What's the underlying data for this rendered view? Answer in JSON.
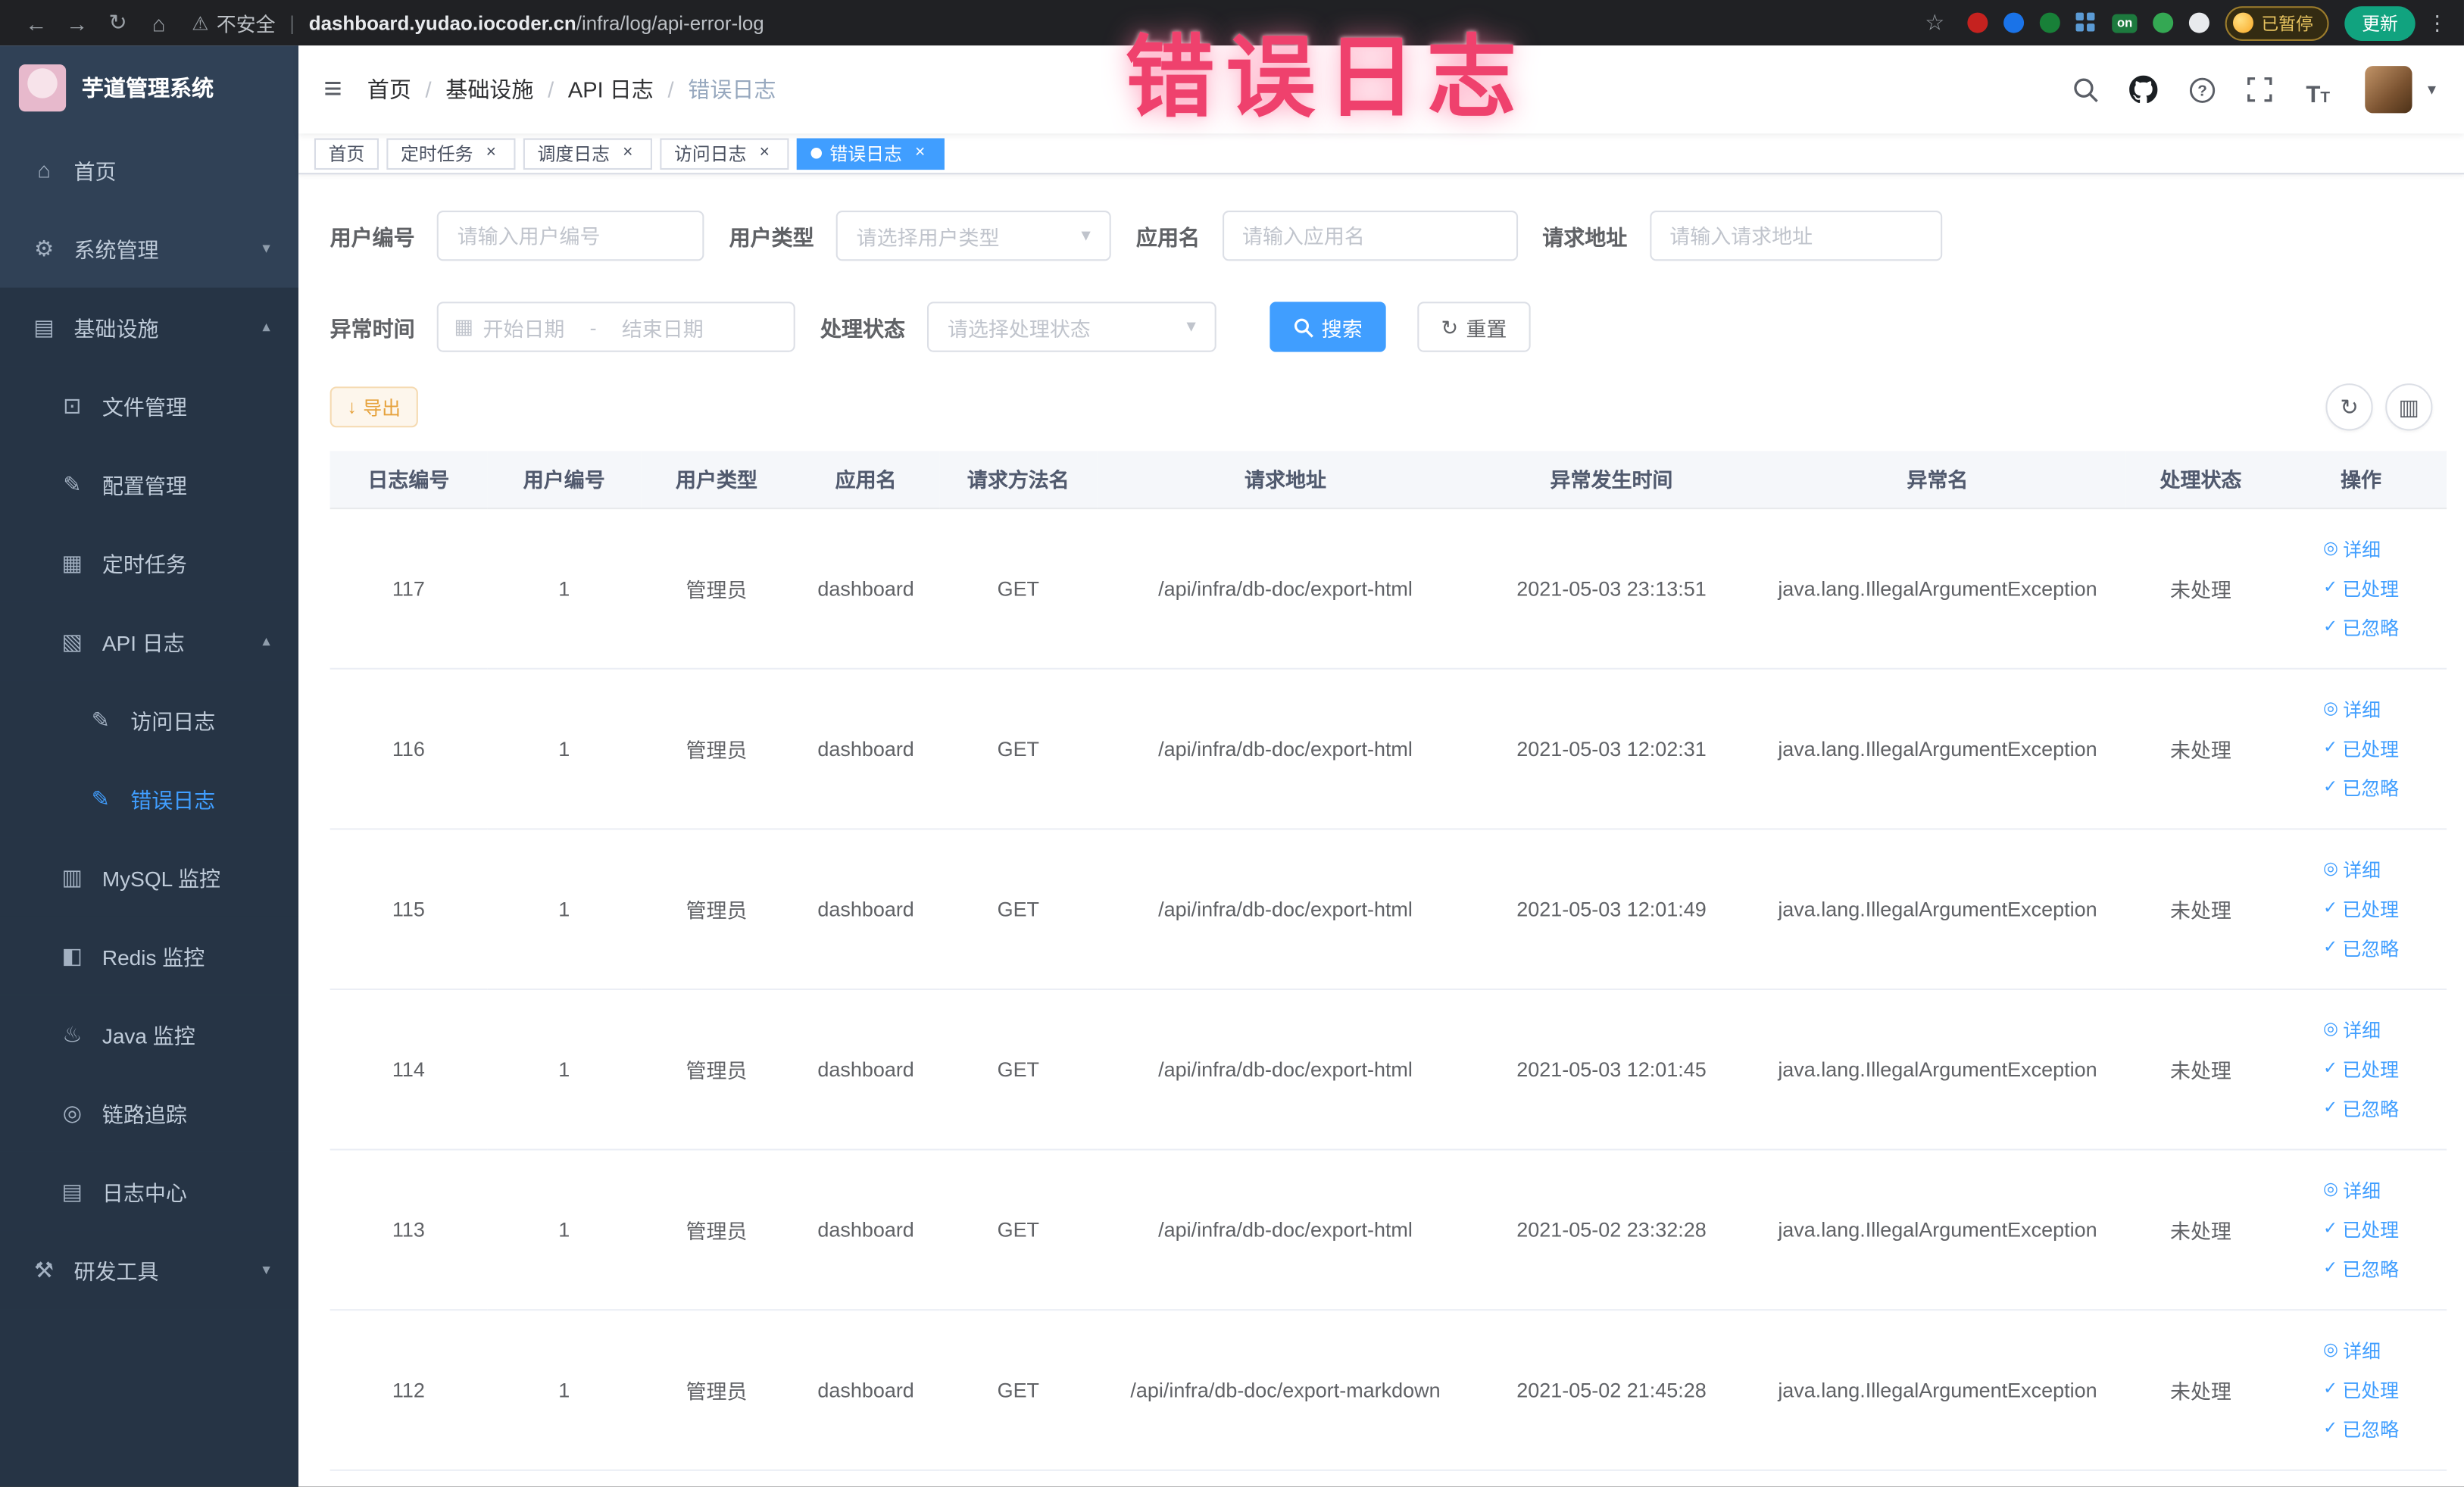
{
  "annotation": {
    "text": "错误日志"
  },
  "browser": {
    "security_label": "不安全",
    "url_host": "dashboard.yudao.iocoder.cn",
    "url_path": "/infra/log/api-error-log",
    "paused_badge": "已暂停",
    "update_button": "更新",
    "extension_on_badge": "on"
  },
  "sidebar": {
    "logo_title": "芋道管理系统",
    "items": [
      {
        "key": "home",
        "label": "首页",
        "icon": "home-icon",
        "level": 0,
        "dark": false,
        "active": false,
        "chevron": null
      },
      {
        "key": "system-management",
        "label": "系统管理",
        "icon": "gear-icon",
        "level": 0,
        "dark": false,
        "active": false,
        "chevron": "down"
      },
      {
        "key": "infrastructure",
        "label": "基础设施",
        "icon": "infrastructure-icon",
        "level": 0,
        "dark": true,
        "active": false,
        "chevron": "up"
      },
      {
        "key": "file-management",
        "label": "文件管理",
        "icon": "file-icon",
        "level": 1,
        "dark": true,
        "active": false,
        "chevron": null
      },
      {
        "key": "config-management",
        "label": "配置管理",
        "icon": "config-icon",
        "level": 1,
        "dark": true,
        "active": false,
        "chevron": null
      },
      {
        "key": "scheduled-tasks",
        "label": "定时任务",
        "icon": "timer-icon",
        "level": 1,
        "dark": true,
        "active": false,
        "chevron": null
      },
      {
        "key": "api-log",
        "label": "API 日志",
        "icon": "api-log-icon",
        "level": 1,
        "dark": true,
        "active": false,
        "chevron": "up"
      },
      {
        "key": "access-log",
        "label": "访问日志",
        "icon": "access-log-icon",
        "level": 2,
        "dark": true,
        "active": false,
        "chevron": null
      },
      {
        "key": "error-log",
        "label": "错误日志",
        "icon": "error-log-icon",
        "level": 2,
        "dark": true,
        "active": true,
        "chevron": null
      },
      {
        "key": "mysql-monitor",
        "label": "MySQL 监控",
        "icon": "mysql-icon",
        "level": 1,
        "dark": true,
        "active": false,
        "chevron": null
      },
      {
        "key": "redis-monitor",
        "label": "Redis 监控",
        "icon": "redis-icon",
        "level": 1,
        "dark": true,
        "active": false,
        "chevron": null
      },
      {
        "key": "java-monitor",
        "label": "Java 监控",
        "icon": "java-icon",
        "level": 1,
        "dark": true,
        "active": false,
        "chevron": null
      },
      {
        "key": "link-trace",
        "label": "链路追踪",
        "icon": "trace-icon",
        "level": 1,
        "dark": true,
        "active": false,
        "chevron": null
      },
      {
        "key": "log-center",
        "label": "日志中心",
        "icon": "log-center-icon",
        "level": 1,
        "dark": true,
        "active": false,
        "chevron": null
      },
      {
        "key": "dev-tools",
        "label": "研发工具",
        "icon": "devtools-icon",
        "level": 0,
        "dark": true,
        "active": false,
        "chevron": "down"
      }
    ]
  },
  "navbar": {
    "breadcrumb": [
      "首页",
      "基础设施",
      "API 日志",
      "错误日志"
    ]
  },
  "tags": [
    {
      "label": "首页",
      "closable": false,
      "active": false
    },
    {
      "label": "定时任务",
      "closable": true,
      "active": false
    },
    {
      "label": "调度日志",
      "closable": true,
      "active": false
    },
    {
      "label": "访问日志",
      "closable": true,
      "active": false
    },
    {
      "label": "错误日志",
      "closable": true,
      "active": true
    }
  ],
  "filters": {
    "user_id": {
      "label": "用户编号",
      "placeholder": "请输入用户编号"
    },
    "user_type": {
      "label": "用户类型",
      "placeholder": "请选择用户类型"
    },
    "app_name": {
      "label": "应用名",
      "placeholder": "请输入应用名"
    },
    "request_url": {
      "label": "请求地址",
      "placeholder": "请输入请求地址"
    },
    "exception_time": {
      "label": "异常时间",
      "start_placeholder": "开始日期",
      "separator": "-",
      "end_placeholder": "结束日期"
    },
    "process_status": {
      "label": "处理状态",
      "placeholder": "请选择处理状态"
    },
    "search_button": "搜索",
    "reset_button": "重置"
  },
  "toolbar": {
    "export_button": "导出"
  },
  "table": {
    "columns": [
      "日志编号",
      "用户编号",
      "用户类型",
      "应用名",
      "请求方法名",
      "请求地址",
      "异常发生时间",
      "异常名",
      "处理状态",
      "操作"
    ],
    "row_actions": [
      "详细",
      "已处理",
      "已忽略"
    ],
    "rows": [
      {
        "id": "117",
        "user_id": "1",
        "user_type": "管理员",
        "app": "dashboard",
        "method": "GET",
        "url": "/api/infra/db-doc/export-html",
        "time": "2021-05-03 23:13:51",
        "exception": "java.lang.IllegalArgumentException",
        "status": "未处理"
      },
      {
        "id": "116",
        "user_id": "1",
        "user_type": "管理员",
        "app": "dashboard",
        "method": "GET",
        "url": "/api/infra/db-doc/export-html",
        "time": "2021-05-03 12:02:31",
        "exception": "java.lang.IllegalArgumentException",
        "status": "未处理"
      },
      {
        "id": "115",
        "user_id": "1",
        "user_type": "管理员",
        "app": "dashboard",
        "method": "GET",
        "url": "/api/infra/db-doc/export-html",
        "time": "2021-05-03 12:01:49",
        "exception": "java.lang.IllegalArgumentException",
        "status": "未处理"
      },
      {
        "id": "114",
        "user_id": "1",
        "user_type": "管理员",
        "app": "dashboard",
        "method": "GET",
        "url": "/api/infra/db-doc/export-html",
        "time": "2021-05-03 12:01:45",
        "exception": "java.lang.IllegalArgumentException",
        "status": "未处理"
      },
      {
        "id": "113",
        "user_id": "1",
        "user_type": "管理员",
        "app": "dashboard",
        "method": "GET",
        "url": "/api/infra/db-doc/export-html",
        "time": "2021-05-02 23:32:28",
        "exception": "java.lang.IllegalArgumentException",
        "status": "未处理"
      },
      {
        "id": "112",
        "user_id": "1",
        "user_type": "管理员",
        "app": "dashboard",
        "method": "GET",
        "url": "/api/infra/db-doc/export-markdown",
        "time": "2021-05-02 21:45:28",
        "exception": "java.lang.IllegalArgumentException",
        "status": "未处理"
      }
    ]
  },
  "colors": {
    "primary": "#409eff",
    "sidebar_bg": "#304156",
    "sidebar_submenu_bg": "#263445",
    "active_menu_text": "#409eff",
    "annotation_pink": "#ef416d",
    "export_warning_text": "#e6a23c",
    "table_header_bg": "#f5f7fa",
    "chrome_update_green": "#11a37f"
  }
}
